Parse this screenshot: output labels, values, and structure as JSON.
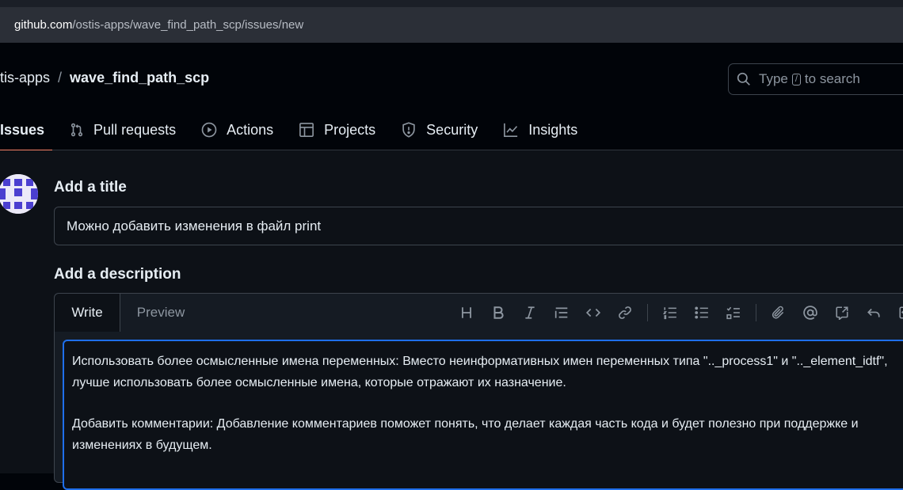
{
  "browser": {
    "url_host": "github.com",
    "url_path": "/ostis-apps/wave_find_path_scp/issues/new"
  },
  "repo": {
    "owner": "tis-apps",
    "separator": "/",
    "name": "wave_find_path_scp"
  },
  "search": {
    "prefix": "Type",
    "key": "/",
    "suffix": "to search"
  },
  "tabs": [
    {
      "label": "Issues",
      "icon": "issues-icon",
      "active": true
    },
    {
      "label": "Pull requests",
      "icon": "pull-request-icon"
    },
    {
      "label": "Actions",
      "icon": "play-icon"
    },
    {
      "label": "Projects",
      "icon": "table-icon"
    },
    {
      "label": "Security",
      "icon": "shield-icon"
    },
    {
      "label": "Insights",
      "icon": "graph-icon"
    }
  ],
  "form": {
    "title_label": "Add a title",
    "title_value": "Можно добавить изменения в файл print",
    "description_label": "Add a description",
    "write_tab": "Write",
    "preview_tab": "Preview",
    "toolbar": [
      "heading-icon",
      "bold-icon",
      "italic-icon",
      "quote-icon",
      "code-icon",
      "link-icon",
      "ordered-list-icon",
      "unordered-list-icon",
      "task-list-icon",
      "attach-icon",
      "mention-icon",
      "reference-icon",
      "undo-icon",
      "saved-reply-icon"
    ],
    "body_paragraph_1": "Использовать более осмысленные имена переменных: Вместо неинформативных имен переменных типа \".._process1\" и \".._element_idtf\", лучше использовать более осмысленные имена, которые отражают их назначение.",
    "body_paragraph_2": "Добавить комментарии: Добавление комментариев поможет понять, что делает каждая часть кода и будет полезно при поддержке и изменениях в будущем."
  },
  "colors": {
    "accent": "#f78166",
    "focus": "#1f6feb",
    "background": "#0d1117"
  }
}
